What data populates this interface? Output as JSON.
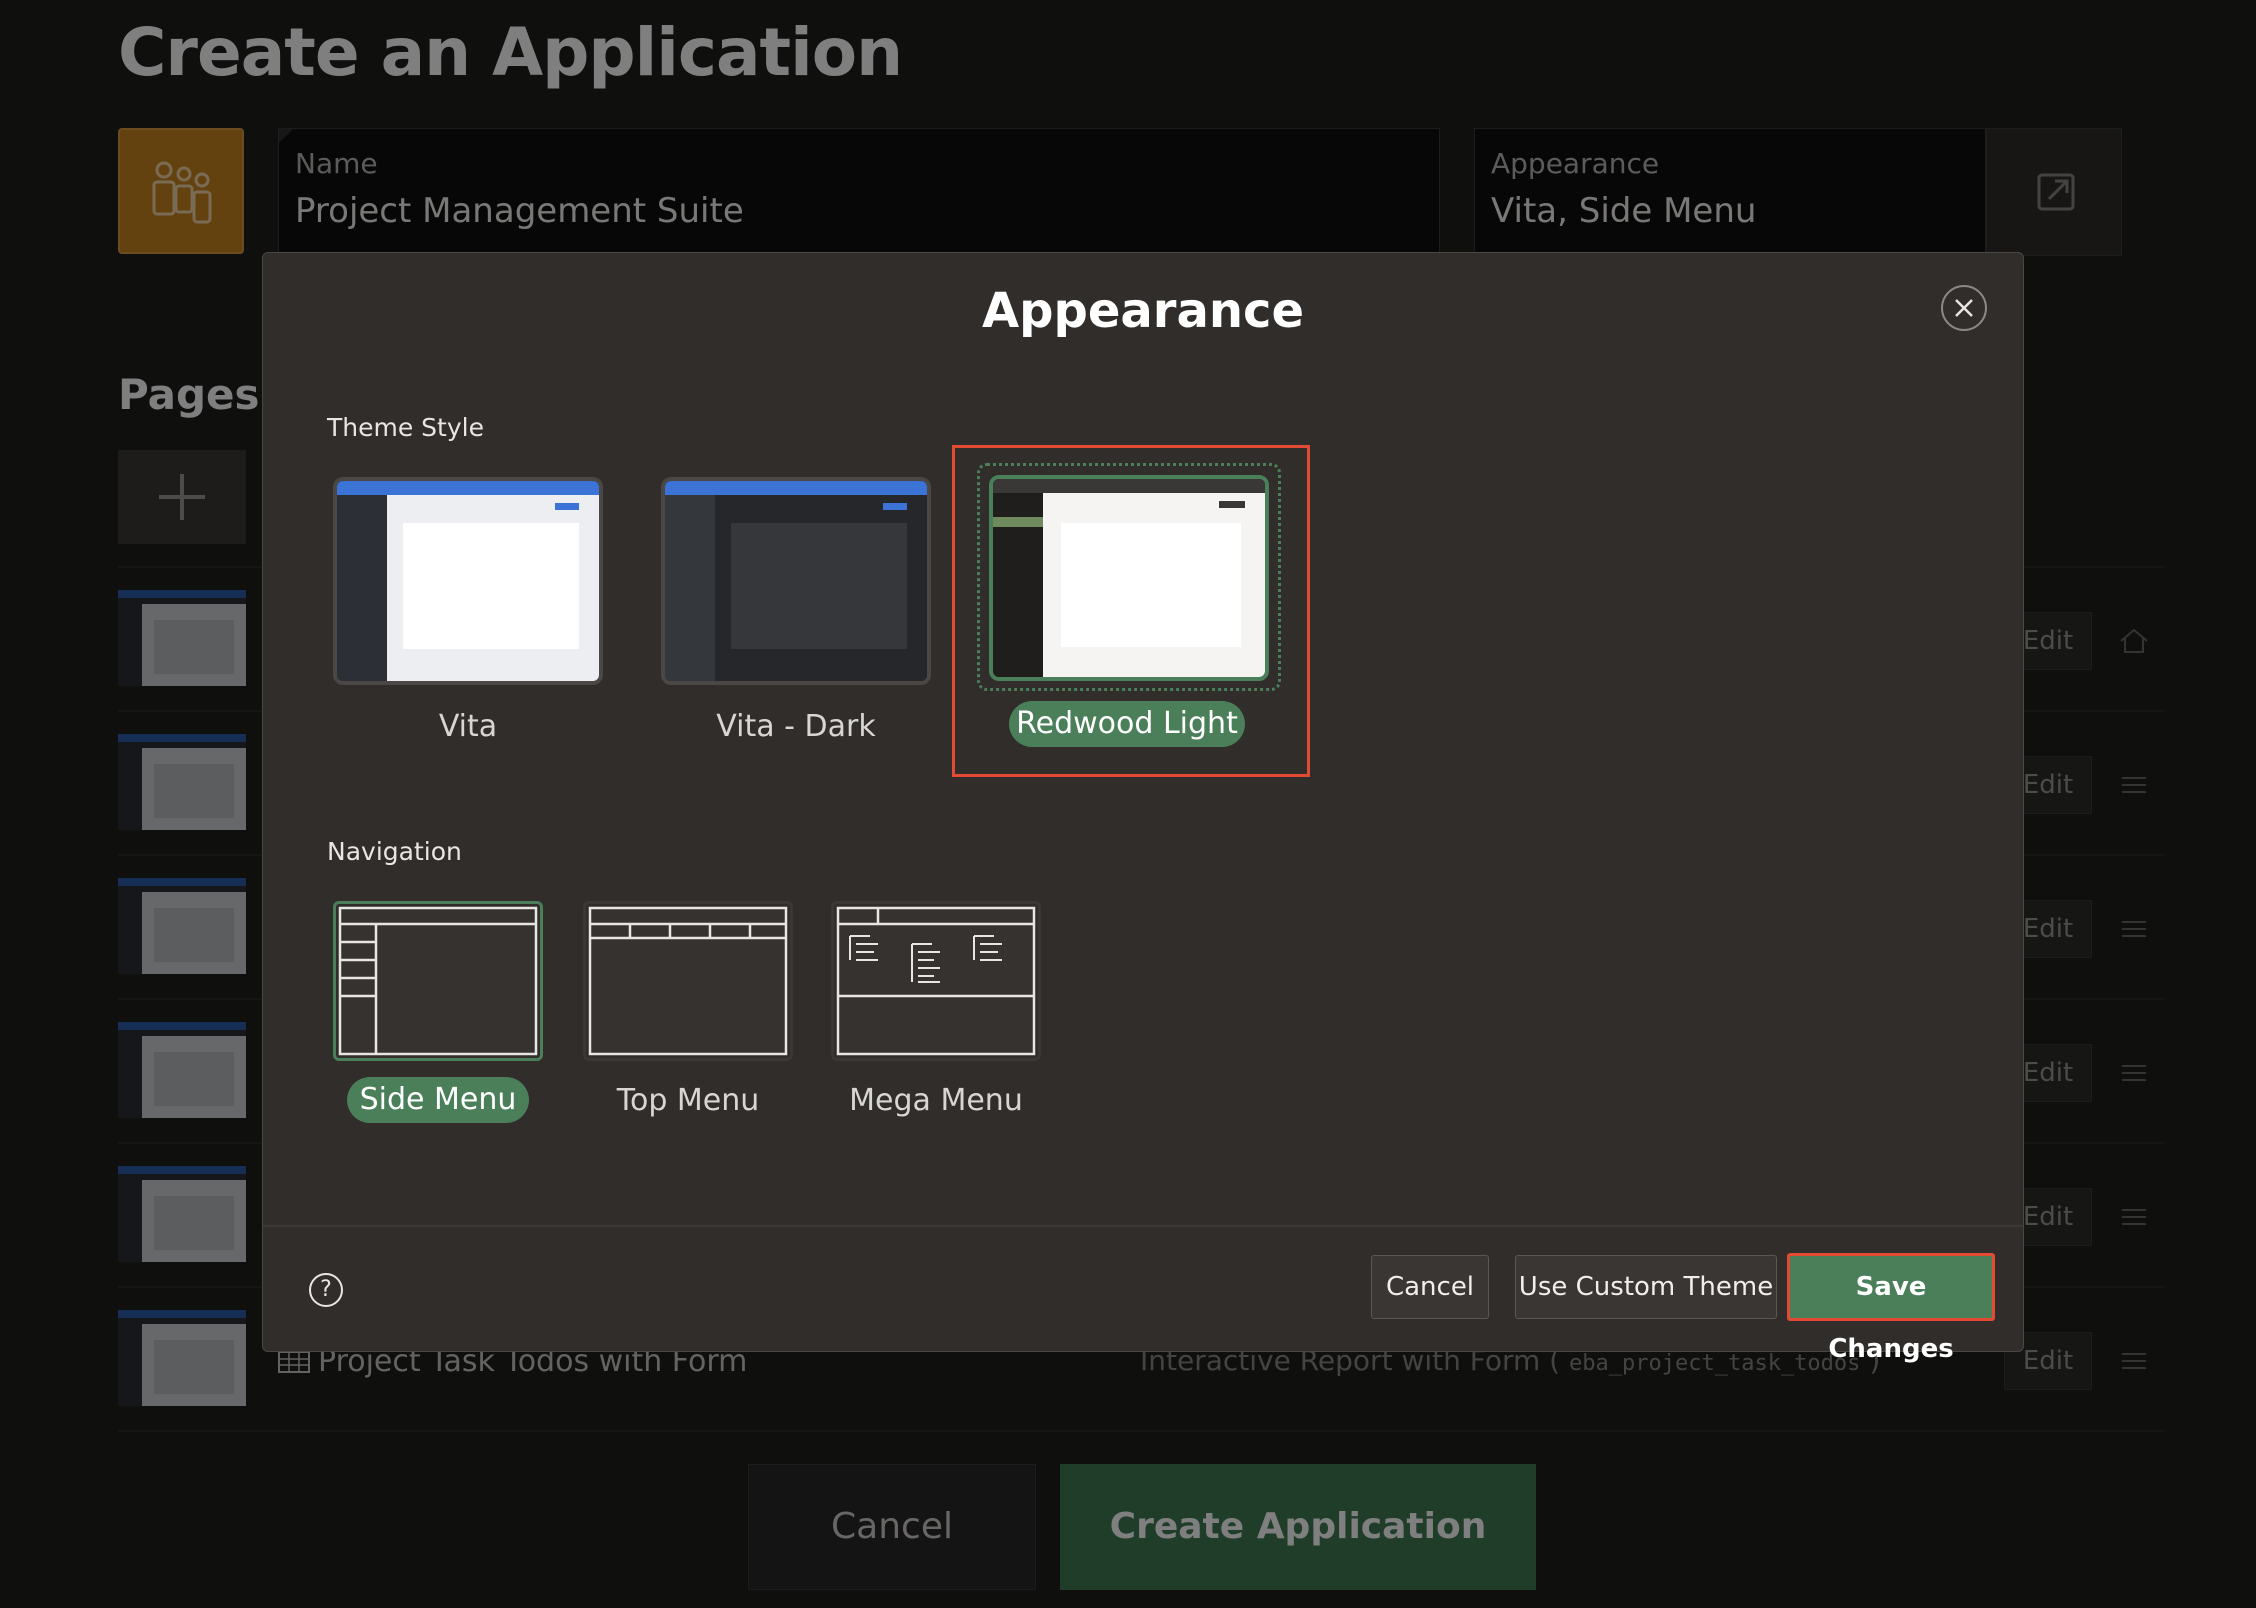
{
  "page": {
    "title": "Create an Application",
    "name_field": {
      "label": "Name",
      "value": "Project Management Suite"
    },
    "appearance_field": {
      "label": "Appearance",
      "value": "Vita, Side Menu"
    },
    "pages_heading": "Pages",
    "visible_row": {
      "title": "Project Task Todos with Form",
      "type": "Interactive Report with Form (",
      "table": "eba_project_task_todos",
      "type_close": ")"
    },
    "edit_label": "Edit",
    "cancel_label": "Cancel",
    "create_label": "Create Application"
  },
  "dialog": {
    "title": "Appearance",
    "theme_style": {
      "label": "Theme Style",
      "options": [
        {
          "label": "Vita",
          "selected": false
        },
        {
          "label": "Vita - Dark",
          "selected": false
        },
        {
          "label": "Redwood Light",
          "selected": true
        }
      ]
    },
    "navigation": {
      "label": "Navigation",
      "options": [
        {
          "label": "Side Menu",
          "selected": true
        },
        {
          "label": "Top Menu",
          "selected": false
        },
        {
          "label": "Mega Menu",
          "selected": false
        }
      ]
    },
    "buttons": {
      "cancel": "Cancel",
      "custom_theme": "Use Custom Theme",
      "save": "Save Changes"
    },
    "help_icon": "?"
  },
  "colors": {
    "accent_green": "#4a7f5a",
    "highlight_red": "#e24a34",
    "app_icon": "#c98420"
  }
}
